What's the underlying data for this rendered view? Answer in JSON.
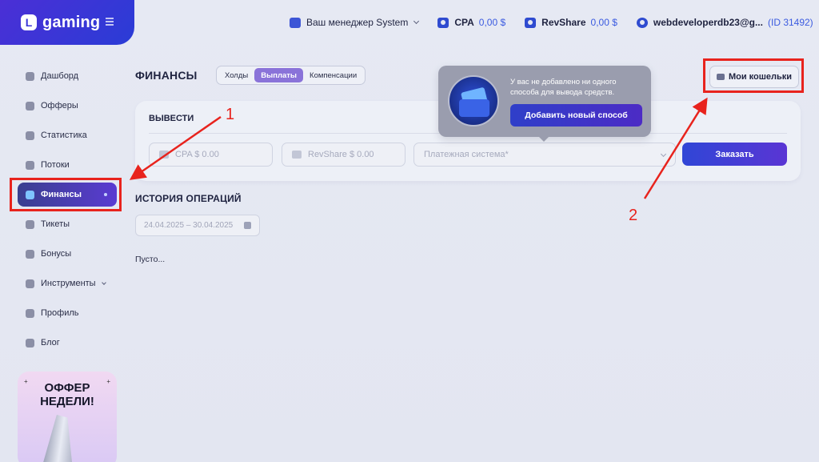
{
  "logo": {
    "text": "gaming",
    "mark": "L"
  },
  "topbar": {
    "manager_label": "Ваш менеджер System",
    "cpa_label": "CPA",
    "cpa_value": "0,00 $",
    "revshare_label": "RevShare",
    "revshare_value": "0,00 $",
    "account_email": "webdeveloperdb23@g...",
    "account_id": "(ID 31492)"
  },
  "sidebar": {
    "items": [
      {
        "label": "Дашборд",
        "icon": "dashboard-icon"
      },
      {
        "label": "Офферы",
        "icon": "offers-icon"
      },
      {
        "label": "Статистика",
        "icon": "stats-icon"
      },
      {
        "label": "Потоки",
        "icon": "streams-icon"
      },
      {
        "label": "Финансы",
        "icon": "finance-icon",
        "active": true
      },
      {
        "label": "Тикеты",
        "icon": "tickets-icon"
      },
      {
        "label": "Бонусы",
        "icon": "bonus-icon"
      },
      {
        "label": "Инструменты",
        "icon": "tools-icon"
      },
      {
        "label": "Профиль",
        "icon": "profile-icon"
      },
      {
        "label": "Блог",
        "icon": "blog-icon"
      }
    ],
    "promo_title_line1": "ОФФЕР",
    "promo_title_line2": "НЕДЕЛИ!"
  },
  "main": {
    "page_title": "ФИНАНСЫ",
    "tabs": [
      "Холды",
      "Выплаты",
      "Компенсации"
    ],
    "active_tab": "Выплаты",
    "wallets_button": "Мои кошельки",
    "withdraw": {
      "title": "ВЫВЕСТИ",
      "cpa_placeholder": "CPA $ 0.00",
      "revshare_placeholder": "RevShare $ 0.00",
      "payment_placeholder": "Платежная система*",
      "order_button": "Заказать"
    },
    "tooltip": {
      "text": "У вас не добавлено ни одного способа для вывода средств.",
      "button": "Добавить новый способ"
    },
    "history": {
      "title": "ИСТОРИЯ ОПЕРАЦИЙ",
      "date_range": "24.04.2025 – 30.04.2025",
      "empty": "Пусто..."
    }
  },
  "annotations": {
    "label_1": "1",
    "label_2": "2",
    "color": "#e8231d"
  }
}
